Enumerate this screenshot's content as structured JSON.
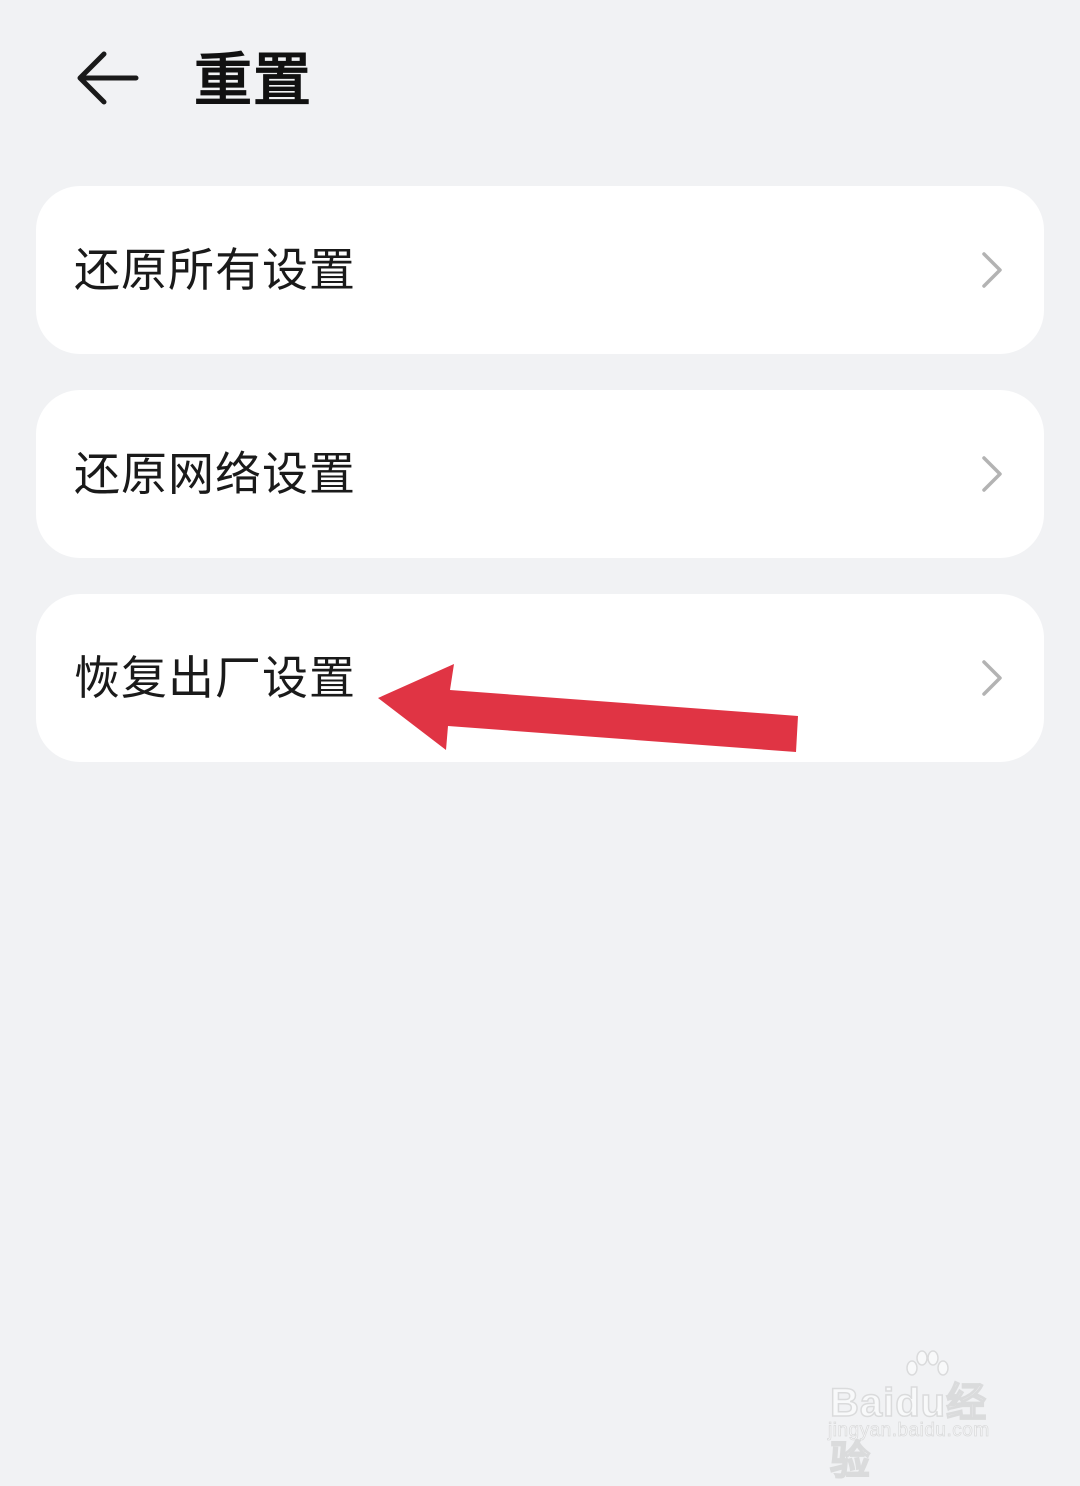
{
  "header": {
    "back_icon": "arrow-left-icon",
    "title": "重置"
  },
  "reset_options": [
    {
      "label": "还原所有设置",
      "icon": "chevron-right-icon"
    },
    {
      "label": "还原网络设置",
      "icon": "chevron-right-icon"
    },
    {
      "label": "恢复出厂设置",
      "icon": "chevron-right-icon"
    }
  ],
  "annotation": {
    "type": "arrow",
    "points_to": "恢复出厂设置",
    "color": "#e03444"
  },
  "watermark": {
    "brand": "Baidu经验",
    "url": "jingyan.baidu.com"
  },
  "colors": {
    "background": "#f1f2f4",
    "card": "#ffffff",
    "text": "#1a1a1a",
    "chevron": "#b3b3b3"
  }
}
